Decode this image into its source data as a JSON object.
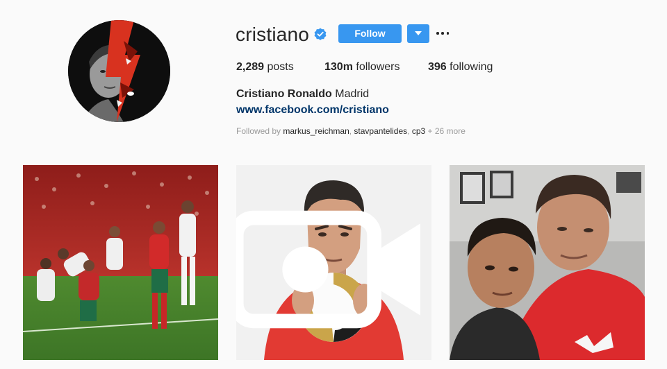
{
  "profile": {
    "username": "cristiano",
    "verified": true,
    "follow_label": "Follow",
    "stats": {
      "posts_count": "2,289",
      "posts_label": "posts",
      "followers_count": "130m",
      "followers_label": "followers",
      "following_count": "396",
      "following_label": "following"
    },
    "full_name": "Cristiano Ronaldo",
    "bio": "Madrid",
    "website": "www.facebook.com/cristiano",
    "followed_by": {
      "prefix": "Followed by",
      "users": [
        "markus_reichman",
        "stavpantelides",
        "cp3"
      ],
      "more": "+ 26 more"
    }
  },
  "posts": [
    {
      "type": "photo",
      "subject": "football match"
    },
    {
      "type": "video",
      "subject": "animated player holding ball"
    },
    {
      "type": "photo",
      "subject": "selfie with child"
    }
  ],
  "colors": {
    "accent": "#3897f0",
    "link": "#003569",
    "muted": "#999999",
    "background": "#fafafa"
  },
  "icons": [
    "verified-badge-icon",
    "chevron-down-icon",
    "more-options-icon",
    "video-icon"
  ]
}
